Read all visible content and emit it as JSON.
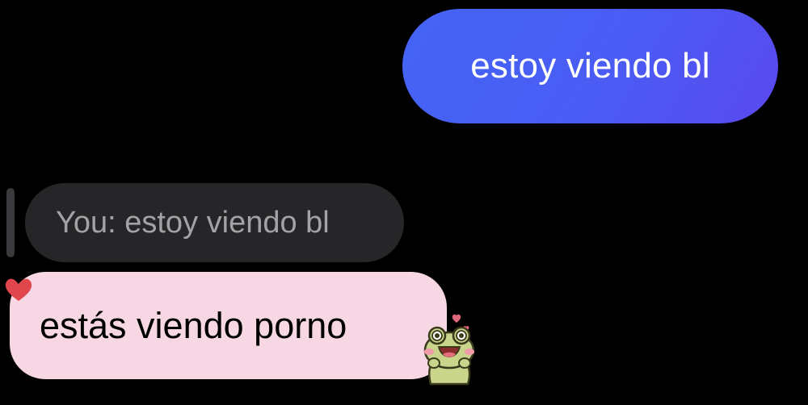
{
  "conversation": {
    "sent_message": {
      "text": "estoy viendo bl",
      "bubble_color": "#4a5cf4"
    },
    "reply_quote": {
      "text": "You: estoy viendo bl",
      "bubble_color": "#262628",
      "text_color": "#a3a3a6"
    },
    "received_message": {
      "text": "estás viendo porno",
      "bubble_color": "#f6d7e3"
    },
    "reaction": {
      "icon": "heart-icon",
      "color": "#e0474c"
    },
    "sticker": {
      "icon": "frog-blushing-sticker"
    }
  }
}
